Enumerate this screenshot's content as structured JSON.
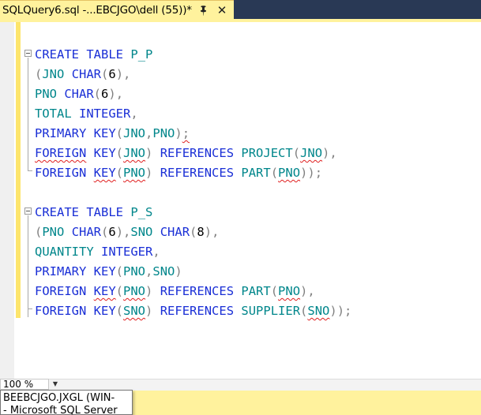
{
  "document_tab": {
    "title": "SQLQuery6.sql -...EBCJGO\\dell (55))*",
    "pin_icon": "pin-icon",
    "close_icon": "close-icon",
    "accent_color": "#fff29d"
  },
  "colors": {
    "keyword": "#1a2fd6",
    "type": "#00868b",
    "punctuation": "#808080",
    "squiggle": "#e02020",
    "change_bar": "#fde56c"
  },
  "editor": {
    "lines": [
      {
        "id": 1,
        "tokens": [
          [
            "kw",
            "CREATE"
          ],
          [
            "tx",
            " "
          ],
          [
            "kw",
            "TABLE"
          ],
          [
            "tx",
            " "
          ],
          [
            "ty",
            "P_P"
          ]
        ]
      },
      {
        "id": 2,
        "tokens": [
          [
            "pu",
            "("
          ],
          [
            "ty",
            "JNO"
          ],
          [
            "tx",
            " "
          ],
          [
            "kw",
            "CHAR"
          ],
          [
            "pu",
            "("
          ],
          [
            "tx",
            "6"
          ],
          [
            "pu",
            "),"
          ]
        ]
      },
      {
        "id": 3,
        "tokens": [
          [
            "ty",
            "PNO"
          ],
          [
            "tx",
            " "
          ],
          [
            "kw",
            "CHAR"
          ],
          [
            "pu",
            "("
          ],
          [
            "tx",
            "6"
          ],
          [
            "pu",
            "),"
          ]
        ]
      },
      {
        "id": 4,
        "tokens": [
          [
            "ty",
            "TOTAL"
          ],
          [
            "tx",
            " "
          ],
          [
            "kw",
            "INTEGER"
          ],
          [
            "pu",
            ","
          ]
        ]
      },
      {
        "id": 5,
        "tokens": [
          [
            "kw",
            "PRIMARY"
          ],
          [
            "tx",
            " "
          ],
          [
            "kw",
            "KEY"
          ],
          [
            "pu",
            "("
          ],
          [
            "ty",
            "JNO"
          ],
          [
            "pu",
            ","
          ],
          [
            "ty",
            "PNO"
          ],
          [
            "pu",
            ")"
          ],
          [
            "pusq",
            ";"
          ]
        ]
      },
      {
        "id": 6,
        "tokens": [
          [
            "kwsq",
            "FOREIGN"
          ],
          [
            "tx",
            " "
          ],
          [
            "kw",
            "KEY"
          ],
          [
            "pu",
            "("
          ],
          [
            "tysq",
            "JNO"
          ],
          [
            "pu",
            ")"
          ],
          [
            "tx",
            " "
          ],
          [
            "kw",
            "REFERENCES"
          ],
          [
            "tx",
            " "
          ],
          [
            "ty",
            "PROJECT"
          ],
          [
            "pu",
            "("
          ],
          [
            "tysq",
            "JNO"
          ],
          [
            "pu",
            "),"
          ]
        ]
      },
      {
        "id": 7,
        "tokens": [
          [
            "kw",
            "FOREIGN"
          ],
          [
            "tx",
            " "
          ],
          [
            "kwsq",
            "KEY"
          ],
          [
            "pu",
            "("
          ],
          [
            "tysq",
            "PNO"
          ],
          [
            "pu",
            ")"
          ],
          [
            "tx",
            " "
          ],
          [
            "kw",
            "REFERENCES"
          ],
          [
            "tx",
            " "
          ],
          [
            "ty",
            "PART"
          ],
          [
            "pu",
            "("
          ],
          [
            "tysq",
            "PNO"
          ],
          [
            "pu",
            "));"
          ]
        ]
      },
      {
        "id": 8,
        "tokens": []
      },
      {
        "id": 9,
        "tokens": [
          [
            "kw",
            "CREATE"
          ],
          [
            "tx",
            " "
          ],
          [
            "kw",
            "TABLE"
          ],
          [
            "tx",
            " "
          ],
          [
            "ty",
            "P_S"
          ]
        ]
      },
      {
        "id": 10,
        "tokens": [
          [
            "pu",
            "("
          ],
          [
            "ty",
            "PNO"
          ],
          [
            "tx",
            " "
          ],
          [
            "kw",
            "CHAR"
          ],
          [
            "pu",
            "("
          ],
          [
            "tx",
            "6"
          ],
          [
            "pu",
            "),"
          ],
          [
            "ty",
            "SNO"
          ],
          [
            "tx",
            " "
          ],
          [
            "kw",
            "CHAR"
          ],
          [
            "pu",
            "("
          ],
          [
            "tx",
            "8"
          ],
          [
            "pu",
            "),"
          ]
        ]
      },
      {
        "id": 11,
        "tokens": [
          [
            "ty",
            "QUANTITY"
          ],
          [
            "tx",
            " "
          ],
          [
            "kw",
            "INTEGER"
          ],
          [
            "pu",
            ","
          ]
        ]
      },
      {
        "id": 12,
        "tokens": [
          [
            "kw",
            "PRIMARY"
          ],
          [
            "tx",
            " "
          ],
          [
            "kw",
            "KEY"
          ],
          [
            "pu",
            "("
          ],
          [
            "ty",
            "PNO"
          ],
          [
            "pu",
            ","
          ],
          [
            "ty",
            "SNO"
          ],
          [
            "pu",
            ")"
          ]
        ]
      },
      {
        "id": 13,
        "tokens": [
          [
            "kw",
            "FOREIGN"
          ],
          [
            "tx",
            " "
          ],
          [
            "kwsq",
            "KEY"
          ],
          [
            "pu",
            "("
          ],
          [
            "tysq",
            "PNO"
          ],
          [
            "pu",
            ")"
          ],
          [
            "tx",
            " "
          ],
          [
            "kw",
            "REFERENCES"
          ],
          [
            "tx",
            " "
          ],
          [
            "ty",
            "PART"
          ],
          [
            "pu",
            "("
          ],
          [
            "tysq",
            "PNO"
          ],
          [
            "pu",
            "),"
          ]
        ]
      },
      {
        "id": 14,
        "tokens": [
          [
            "kw",
            "FOREIGN"
          ],
          [
            "tx",
            " "
          ],
          [
            "kw",
            "KEY"
          ],
          [
            "pu",
            "("
          ],
          [
            "tysq",
            "SNO"
          ],
          [
            "pu",
            ")"
          ],
          [
            "tx",
            " "
          ],
          [
            "kw",
            "REFERENCES"
          ],
          [
            "tx",
            " "
          ],
          [
            "ty",
            "SUPPLIER"
          ],
          [
            "pu",
            "("
          ],
          [
            "tysq",
            "SNO"
          ],
          [
            "pu",
            "));"
          ]
        ]
      }
    ]
  },
  "zoom": {
    "value": "100 %",
    "dropdown_icon": "chevron-down-icon"
  },
  "tooltip": {
    "line1": "BEEBCJGO.JXGL (WIN-",
    "line2": "- Microsoft SQL Server"
  }
}
